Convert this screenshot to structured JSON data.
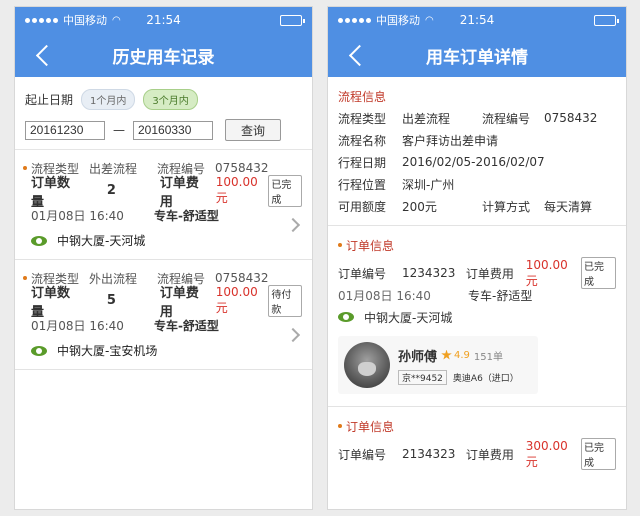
{
  "status_bar": {
    "carrier": "中国移动",
    "time": "21:54"
  },
  "left": {
    "nav_title": "历史用车记录",
    "filter": {
      "label": "起止日期",
      "chips": [
        "1个月内",
        "3个月内"
      ],
      "start_date": "20161230",
      "separator": "—",
      "end_date": "20160330",
      "query_label": "查询"
    },
    "orders": [
      {
        "flow_type_label": "流程类型",
        "flow_type": "出差流程",
        "flow_no_label": "流程编号",
        "flow_no": "0758432",
        "qty_label": "订单数量",
        "qty": "2",
        "fee_label": "订单费用",
        "fee": "100.00元",
        "status": "已完成",
        "datetime": "01月08日 16:40",
        "car_type": "专车-舒适型",
        "location": "中钢大厦-天河城"
      },
      {
        "flow_type_label": "流程类型",
        "flow_type": "外出流程",
        "flow_no_label": "流程编号",
        "flow_no": "0758432",
        "qty_label": "订单数量",
        "qty": "5",
        "fee_label": "订单费用",
        "fee": "100.00元",
        "status": "待付款",
        "datetime": "01月08日 16:40",
        "car_type": "专车-舒适型",
        "location": "中钢大厦-宝安机场"
      }
    ]
  },
  "right": {
    "nav_title": "用车订单详情",
    "flow_info": {
      "title": "流程信息",
      "type_label": "流程类型",
      "type": "出差流程",
      "no_label": "流程编号",
      "no": "0758432",
      "name_label": "流程名称",
      "name": "客户拜访出差申请",
      "date_label": "行程日期",
      "date": "2016/02/05-2016/02/07",
      "place_label": "行程位置",
      "place": "深圳-广州",
      "quota_label": "可用额度",
      "quota": "200元",
      "calc_label": "计算方式",
      "calc": "每天清算"
    },
    "order1": {
      "title": "订单信息",
      "no_label": "订单编号",
      "no": "1234323",
      "fee_label": "订单费用",
      "fee": "100.00元",
      "status": "已完成",
      "datetime": "01月08日 16:40",
      "car_type": "专车-舒适型",
      "location": "中钢大厦-天河城",
      "driver": {
        "name": "孙师傅",
        "rating": "4.9",
        "trips": "151单",
        "plate": "京**9452",
        "car": "奥迪A6（进口）"
      }
    },
    "order2": {
      "title": "订单信息",
      "no_label": "订单编号",
      "no": "2134323",
      "fee_label": "订单费用",
      "fee": "300.00元",
      "status": "已完成"
    }
  }
}
